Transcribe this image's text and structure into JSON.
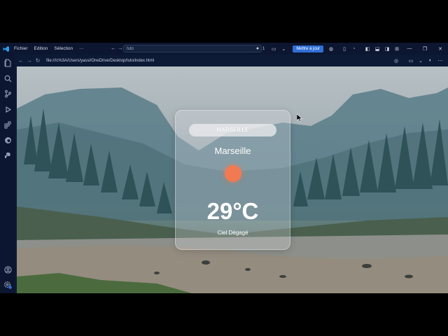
{
  "titlebar": {
    "menu": [
      "Fichier",
      "Edition",
      "Sélection",
      "···"
    ],
    "command_center": "tuto",
    "count": "1",
    "update_label": "Mettre à jour"
  },
  "browser": {
    "url": "file:///c%3A/Users/yassi/OneDrive/Desktop/tuto/index.html"
  },
  "weather": {
    "search_label": "MARSEILLE",
    "city": "Marseille",
    "temperature": "29°C",
    "description": "Ciel Dégagé",
    "sun_color": "#f17a52"
  },
  "colors": {
    "accent": "#2f6fd6",
    "chrome": "#0c1630"
  },
  "icons": [
    "vscode-logo-icon",
    "files-icon",
    "search-icon",
    "source-control-icon",
    "run-debug-icon",
    "extensions-icon",
    "edge-icon",
    "python-icon",
    "account-icon",
    "settings-icon",
    "copilot-icon",
    "layout-icon",
    "back-arrow-icon",
    "forward-arrow-icon",
    "reload-icon"
  ]
}
